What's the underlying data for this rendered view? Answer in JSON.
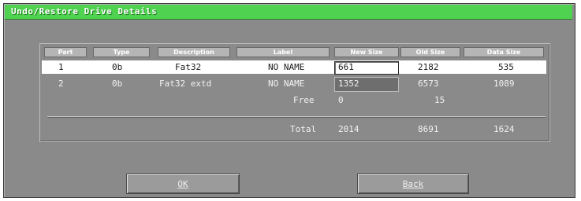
{
  "window": {
    "title": "Undo/Restore Drive Details"
  },
  "table": {
    "headers": [
      "Part",
      "Type",
      "Description",
      "Label",
      "New Size",
      "Old Size",
      "Data Size"
    ],
    "rows": [
      {
        "part": "1",
        "type": "0b",
        "description": "Fat32",
        "label": "NO NAME",
        "new_size": "661",
        "old_size": "2182",
        "data_size": "535"
      },
      {
        "part": "2",
        "type": "0b",
        "description": "Fat32 extd",
        "label": "NO NAME",
        "new_size": "1352",
        "old_size": "6573",
        "data_size": "1089"
      }
    ],
    "free": {
      "label": "Free",
      "new_size": "0",
      "old_size": "15"
    },
    "total": {
      "label": "Total",
      "new_size": "2014",
      "old_size": "8691",
      "data_size": "1624"
    }
  },
  "buttons": {
    "ok": "OK",
    "back": "Back"
  }
}
